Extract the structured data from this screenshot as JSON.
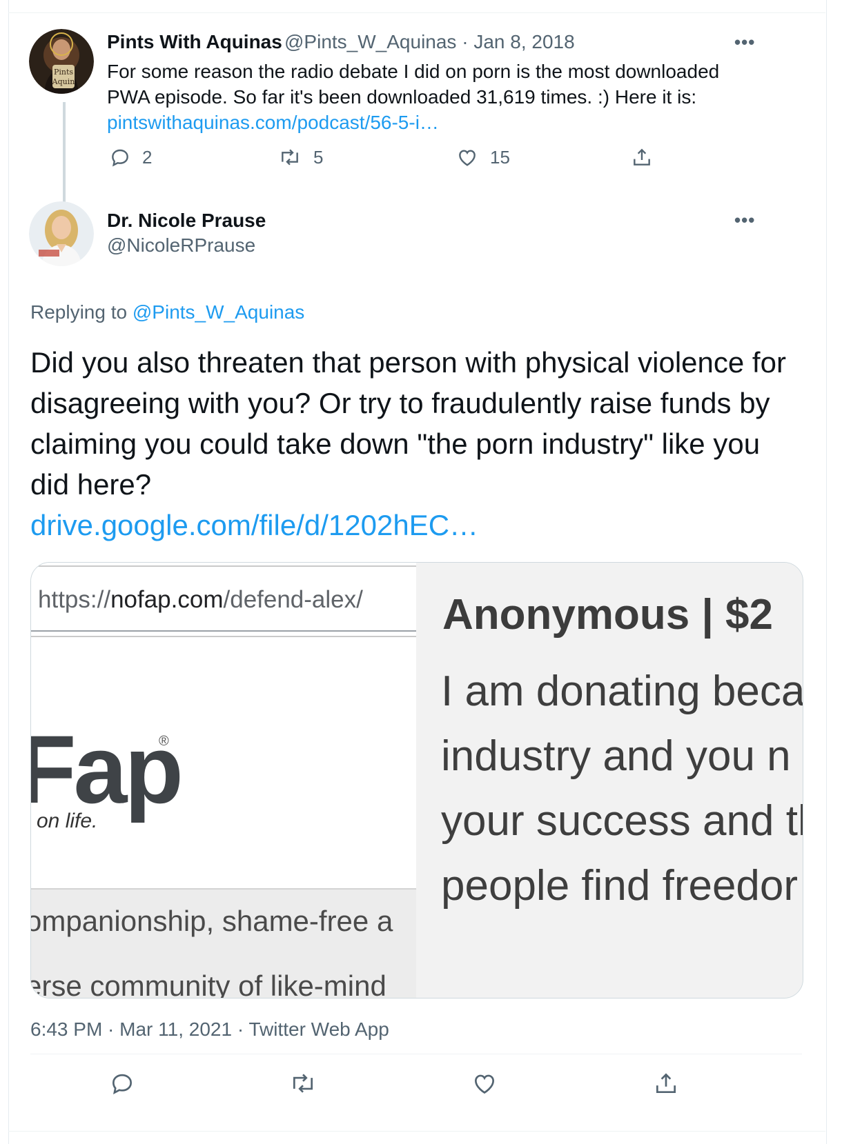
{
  "parent_tweet": {
    "display_name": "Pints With Aquinas",
    "handle": "@Pints_W_Aquinas",
    "separator": "·",
    "date": "Jan 8, 2018",
    "text": "For some reason the radio debate I did on porn is the most downloaded PWA episode. So far it's been downloaded 31,619 times. :) Here it is:",
    "link_text": "pintswithaquinas.com/podcast/56-5-i…",
    "more_label": "•••",
    "actions": {
      "reply_count": "2",
      "retweet_count": "5",
      "like_count": "15"
    }
  },
  "main_tweet": {
    "display_name": "Dr. Nicole Prause",
    "handle": "@NicoleRPrause",
    "more_label": "•••",
    "replying_prefix": "Replying to",
    "replying_handle": "@Pints_W_Aquinas",
    "text": "Did you also threaten that person with physical violence for disagreeing with you? Or try to fraudulently raise funds by claiming you could take down \"the porn industry\" like you did here?",
    "link_text": "drive.google.com/file/d/1202hEC…",
    "timestamp": "6:43 PM · Mar 11, 2021 · Twitter Web App"
  },
  "media_card": {
    "url_scheme": "https://",
    "url_host": "nofap.com",
    "url_path": "/defend-alex/",
    "logo_text": "Fap",
    "logo_mark": "®",
    "tagline": "on life.",
    "left_line1": "ompanionship, shame-free a",
    "left_line2": "erse community of like-mind",
    "donor_header": "Anonymous | $2",
    "donor_lines": [
      "I am donating beca",
      "industry and you n",
      "your success and th",
      "people find freedor"
    ]
  },
  "colors": {
    "link": "#1d9bf0",
    "secondary_text": "#536471",
    "primary_text": "#0f1419",
    "thread_line": "#cfd9de"
  },
  "icons": [
    "reply-icon",
    "retweet-icon",
    "like-icon",
    "share-icon",
    "more-icon"
  ]
}
